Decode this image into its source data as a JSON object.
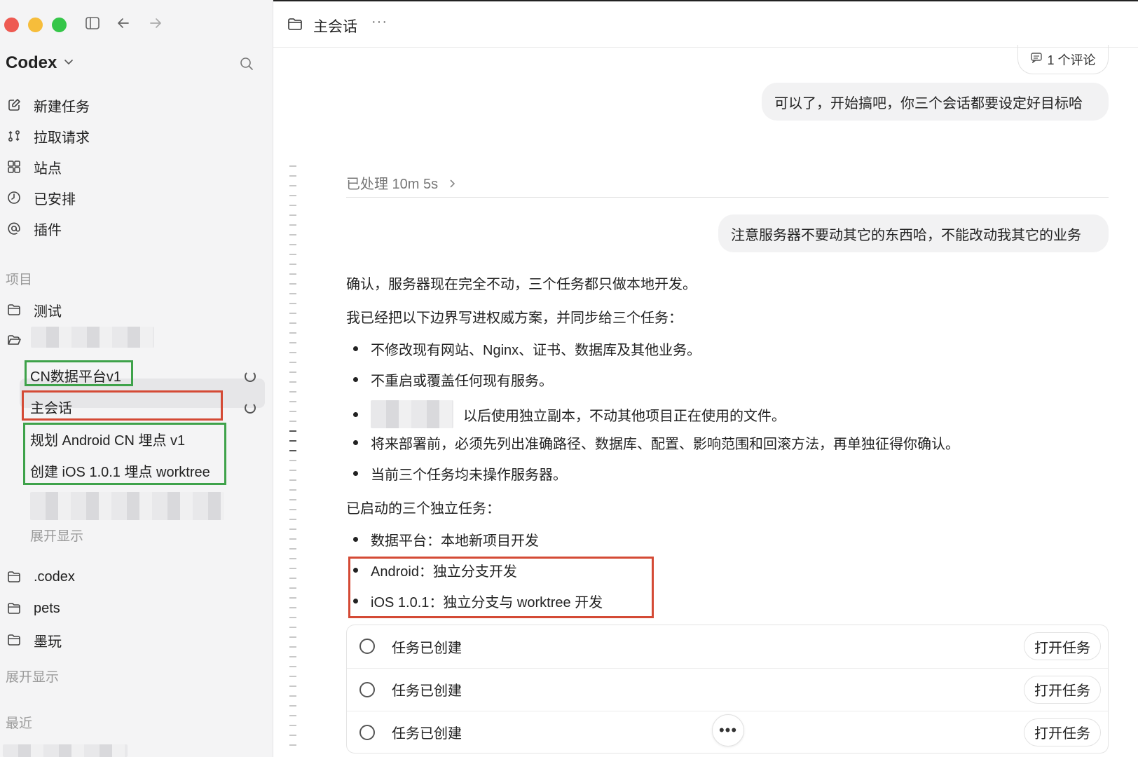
{
  "sidebar": {
    "app_title": "Codex",
    "nav": [
      {
        "label": "新建任务",
        "icon": "edit-icon"
      },
      {
        "label": "拉取请求",
        "icon": "pull-request-icon"
      },
      {
        "label": "站点",
        "icon": "grid-icon"
      },
      {
        "label": "已安排",
        "icon": "clock-icon"
      },
      {
        "label": "插件",
        "icon": "at-icon"
      }
    ],
    "projects_label": "项目",
    "projects": [
      {
        "label": "测试",
        "icon": "folder-icon"
      }
    ],
    "tasks": [
      {
        "label": "CN数据平台v1"
      },
      {
        "label": "主会话"
      },
      {
        "label": "规划 Android CN 埋点 v1"
      },
      {
        "label": "创建 iOS 1.0.1 埋点 worktree"
      }
    ],
    "expand_label_1": "展开显示",
    "folders": [
      {
        "label": ".codex"
      },
      {
        "label": "pets"
      },
      {
        "label": "墨玩"
      }
    ],
    "expand_label_2": "展开显示",
    "recent_label": "最近"
  },
  "header": {
    "title": "主会话",
    "more": "···"
  },
  "conversation": {
    "comment_count": "1 个评论",
    "user_msg_1": "可以了，开始搞吧，你三个会话都要设定好目标哈",
    "processed": "已处理 10m 5s",
    "user_msg_2": "注意服务器不要动其它的东西哈，不能改动我其它的业务",
    "reply_p1": "确认，服务器现在完全不动，三个任务都只做本地开发。",
    "reply_p2": "我已经把以下边界写进权威方案，并同步给三个任务：",
    "bullets_1": [
      "不修改现有网站、Nginx、证书、数据库及其他业务。",
      "不重启或覆盖任何现有服务。",
      "以后使用独立副本，不动其他项目正在使用的文件。",
      "将来部署前，必须先列出准确路径、数据库、配置、影响范围和回滚方法，再单独征得你确认。",
      "当前三个任务均未操作服务器。"
    ],
    "reply_p3": "已启动的三个独立任务：",
    "bullets_2": [
      "数据平台：本地新项目开发",
      "Android：独立分支开发",
      "iOS 1.0.1：独立分支与 worktree 开发"
    ],
    "task_rows": [
      {
        "label": "任务已创建",
        "button": "打开任务"
      },
      {
        "label": "任务已创建",
        "button": "打开任务"
      },
      {
        "label": "任务已创建",
        "button": "打开任务"
      }
    ],
    "float_more": "•••"
  }
}
